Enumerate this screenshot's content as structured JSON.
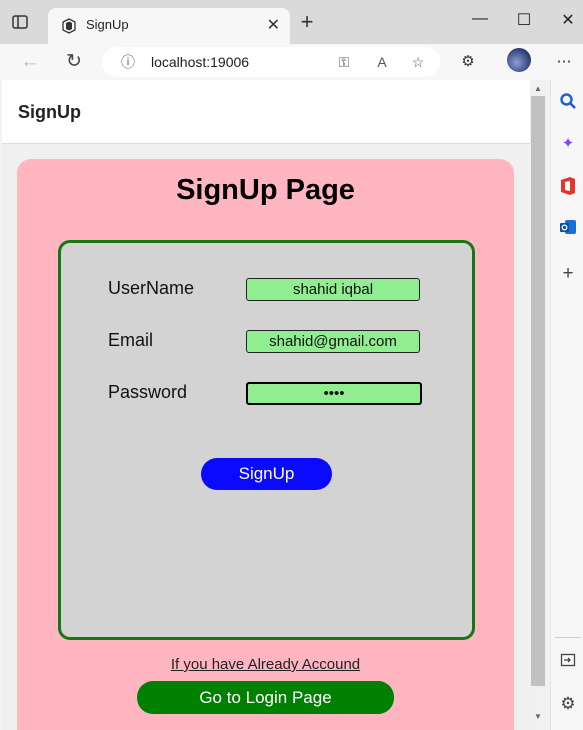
{
  "browser": {
    "tab_title": "SignUp",
    "tab_close": "✕",
    "new_tab": "+",
    "url": "localhost:19006",
    "window_controls": {
      "minimize": "—",
      "maximize": "☐",
      "close": "✕"
    }
  },
  "navbar": {
    "title": "SignUp"
  },
  "signup": {
    "heading": "SignUp Page",
    "username_label": "UserName",
    "username_value": "shahid iqbal",
    "email_label": "Email",
    "email_value": "shahid@gmail.com",
    "password_label": "Password",
    "password_value": "••••",
    "submit_label": "SignUp",
    "login_prompt": "If you have Already Accound",
    "login_button": "Go to Login Page"
  },
  "colors": {
    "card": "#ffb6c1",
    "form_border": "#137a13",
    "input_fill": "#90ee90",
    "submit_button": "#0a0aff",
    "login_button": "#008000"
  },
  "icons": [
    "tab-actions-icon",
    "app-favicon",
    "back-icon",
    "refresh-icon",
    "info-icon",
    "key-icon",
    "read-aloud-icon",
    "add-favorite-icon",
    "extensions-icon",
    "profile-avatar",
    "more-icon",
    "search-icon",
    "copilot-icon",
    "office-icon",
    "outlook-icon",
    "add-icon",
    "sidebar-toggle-icon",
    "settings-icon"
  ]
}
